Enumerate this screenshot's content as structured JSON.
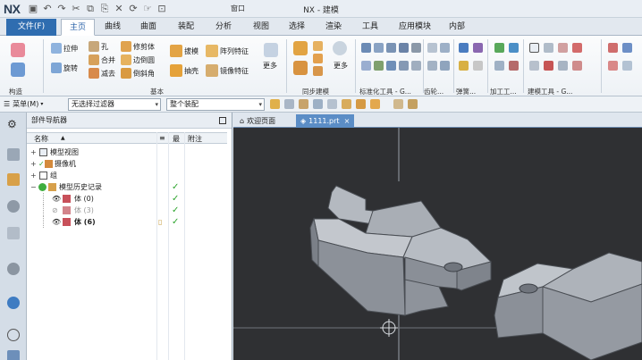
{
  "app": {
    "logo": "NX",
    "title": "NX - 建模",
    "window_menu": "窗口"
  },
  "tabs": {
    "file": "文件(F)",
    "items": [
      "主页",
      "曲线",
      "曲面",
      "装配",
      "分析",
      "视图",
      "选择",
      "渲染",
      "工具",
      "应用模块",
      "内部"
    ],
    "active": "主页"
  },
  "ribbon": {
    "feature": {
      "items": [
        "拉伸",
        "旋转",
        "孔",
        "合并",
        "减去",
        "修剪体",
        "边倒圆",
        "倒斜角",
        "拔模",
        "抽壳",
        "阵列特征",
        "镜像特征"
      ],
      "more": "更多"
    },
    "sync": {
      "more": "更多"
    },
    "groups": {
      "direct": "构造",
      "base": "基本",
      "sync": "同步建模",
      "standard": "标准化工具 - G...",
      "gear": "齿轮...",
      "spring": "弹簧...",
      "machining": "加工工...",
      "modeling_tools": "建模工具 - G..."
    }
  },
  "filterbar": {
    "menu": "菜单(M)",
    "filter": "无选择过滤器",
    "scope": "整个装配"
  },
  "navigator": {
    "title": "部件导航器",
    "columns": {
      "name": "名称",
      "c2": "最",
      "c3": "附注"
    },
    "rows": [
      {
        "label": "模型视图",
        "check": ""
      },
      {
        "label": "摄像机",
        "check": ""
      },
      {
        "label": "组",
        "check": ""
      },
      {
        "label": "模型历史记录",
        "check": "✓"
      },
      {
        "label": "体 (0)",
        "check": "✓"
      },
      {
        "label": "体 (3)",
        "check": "✓"
      },
      {
        "label": "体 (6)",
        "check": "✓"
      }
    ]
  },
  "doc_tabs": {
    "home": "欢迎页面",
    "part": "1111.prt",
    "close": "×"
  },
  "colors": {
    "accent": "#2f6db0",
    "viewport_bg": "#2f3033",
    "part_gray": "#8e939b",
    "check_green": "#2fa52f"
  }
}
